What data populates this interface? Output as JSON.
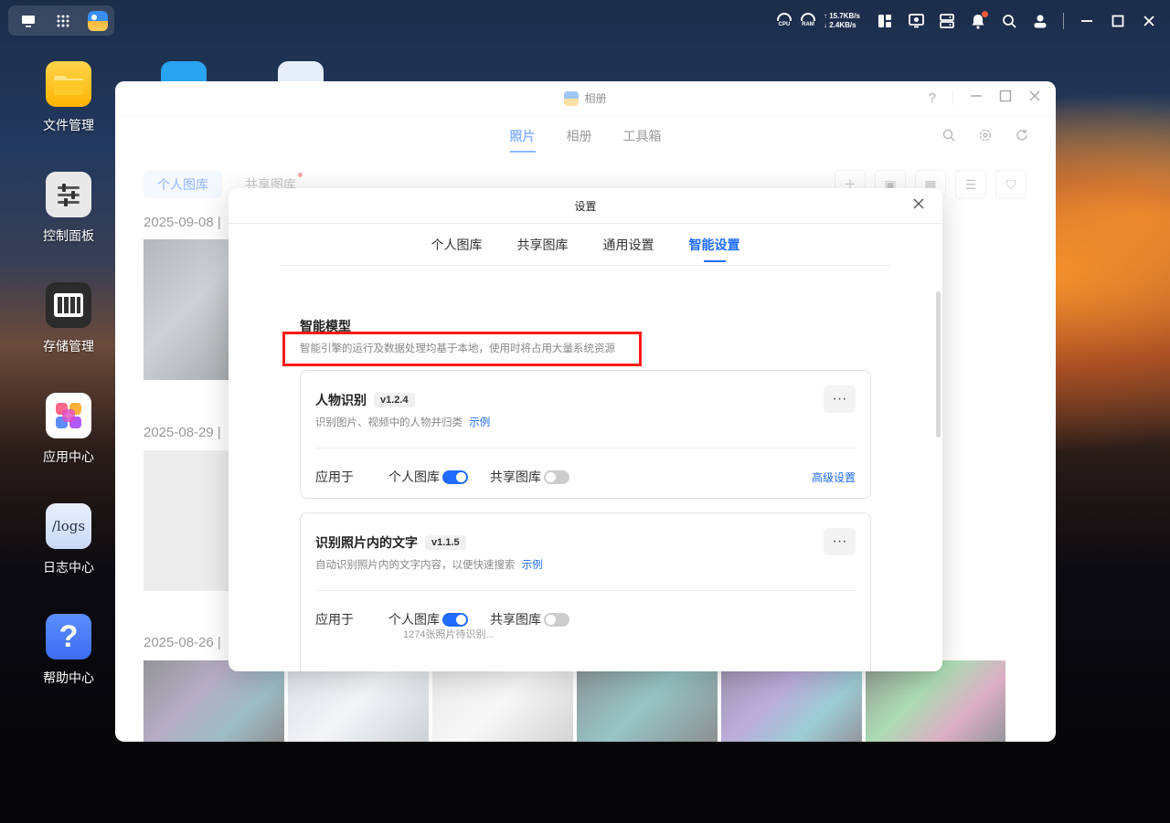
{
  "topbar": {
    "cpu_label": "CPU",
    "ram_label": "RAM",
    "net_up": "15.7KB/s",
    "net_down": "2.4KB/s"
  },
  "desktop": {
    "icons": [
      {
        "label": "文件管理",
        "icon": "folder-icon"
      },
      {
        "label": "控制面板",
        "icon": "sliders-icon"
      },
      {
        "label": "存储管理",
        "icon": "storage-icon"
      },
      {
        "label": "应用中心",
        "icon": "app-center-icon"
      },
      {
        "label": "日志中心",
        "icon": "logs-icon",
        "icon_text": "/logs"
      },
      {
        "label": "帮助中心",
        "icon": "help-icon",
        "icon_text": "?"
      }
    ]
  },
  "album_window": {
    "title": "相册",
    "nav": [
      "照片",
      "相册",
      "工具箱"
    ],
    "lib_tabs": [
      "个人图库",
      "共享图库"
    ],
    "dates": [
      "2025-09-08 |",
      "2025-08-29 |",
      "2025-08-26 |"
    ]
  },
  "settings": {
    "title": "设置",
    "tabs": [
      "个人图库",
      "共享图库",
      "通用设置",
      "智能设置"
    ],
    "active_tab": "智能设置",
    "section_title": "智能模型",
    "section_desc": "智能引擎的运行及数据处理均基于本地，使用时将占用大量系统资源",
    "cards": [
      {
        "title": "人物识别",
        "version": "v1.2.4",
        "desc": "识别图片、视频中的人物并归类",
        "example_link": "示例",
        "apply_label": "应用于",
        "personal_label": "个人图库",
        "personal_on": true,
        "shared_label": "共享图库",
        "shared_on": false,
        "advanced_link": "高级设置"
      },
      {
        "title": "识别照片内的文字",
        "version": "v1.1.5",
        "desc": "自动识别照片内的文字内容，以便快速搜索",
        "example_link": "示例",
        "apply_label": "应用于",
        "personal_label": "个人图库",
        "personal_on": true,
        "pending_text": "1274张照片待识别...",
        "shared_label": "共享图库",
        "shared_on": false
      }
    ]
  }
}
